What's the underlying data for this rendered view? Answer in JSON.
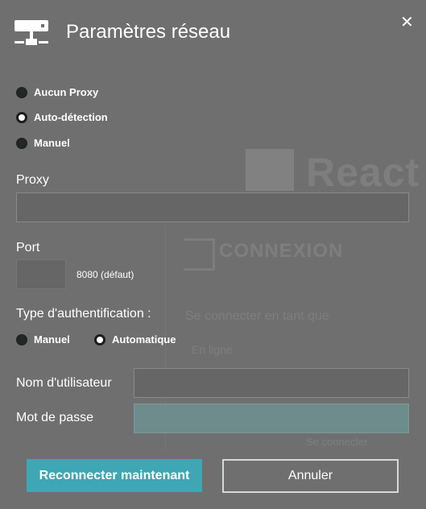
{
  "dialog": {
    "title": "Paramètres réseau",
    "close_symbol": "✕",
    "header_icon": "network-icon"
  },
  "proxy_mode": {
    "options": [
      {
        "label": "Aucun Proxy",
        "selected": false
      },
      {
        "label": "Auto-détection",
        "selected": true
      },
      {
        "label": "Manuel",
        "selected": false
      }
    ]
  },
  "proxy": {
    "label": "Proxy",
    "value": ""
  },
  "port": {
    "label": "Port",
    "value": "",
    "hint": "8080 (défaut)"
  },
  "auth": {
    "label": "Type d'authentification :",
    "options": [
      {
        "label": "Manuel",
        "selected": false
      },
      {
        "label": "Automatique",
        "selected": true
      }
    ]
  },
  "username": {
    "label": "Nom d'utilisateur",
    "value": ""
  },
  "password": {
    "label": "Mot de passe",
    "value": ""
  },
  "buttons": {
    "reconnect": "Reconnecter maintenant",
    "cancel": "Annuler"
  },
  "background": {
    "brand": "React",
    "login_title": "CONNEXION",
    "hint1": "Se connecter en tant que",
    "hint2": "En ligne",
    "hint3": "Se connecter"
  },
  "colors": {
    "overlay": "#6f6f6f",
    "primary_button": "#3fa6b4",
    "field": "#666666",
    "password_field": "#6f8c8d"
  }
}
